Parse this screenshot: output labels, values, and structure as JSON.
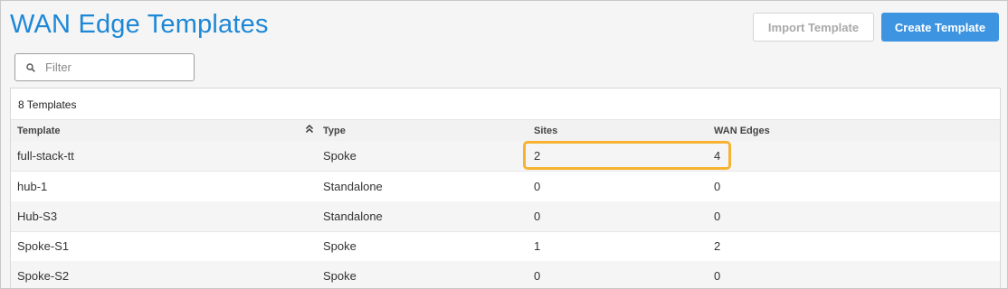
{
  "header": {
    "title": "WAN Edge Templates",
    "import_label": "Import Template",
    "create_label": "Create Template"
  },
  "filter": {
    "placeholder": "Filter"
  },
  "table": {
    "count_label": "8 Templates",
    "columns": [
      "Template",
      "Type",
      "Sites",
      "WAN Edges"
    ],
    "rows": [
      [
        "full-stack-tt",
        "Spoke",
        "2",
        "4"
      ],
      [
        "hub-1",
        "Standalone",
        "0",
        "0"
      ],
      [
        "Hub-S3",
        "Standalone",
        "0",
        "0"
      ],
      [
        "Spoke-S1",
        "Spoke",
        "1",
        "2"
      ],
      [
        "Spoke-S2",
        "Spoke",
        "0",
        "0"
      ]
    ]
  },
  "colors": {
    "title": "#1e88d6",
    "primary_button": "#3d95e2",
    "highlight": "#f5b331"
  },
  "icons": {
    "filter": "search-icon",
    "sort": "sort-chevrons-up-icon"
  }
}
